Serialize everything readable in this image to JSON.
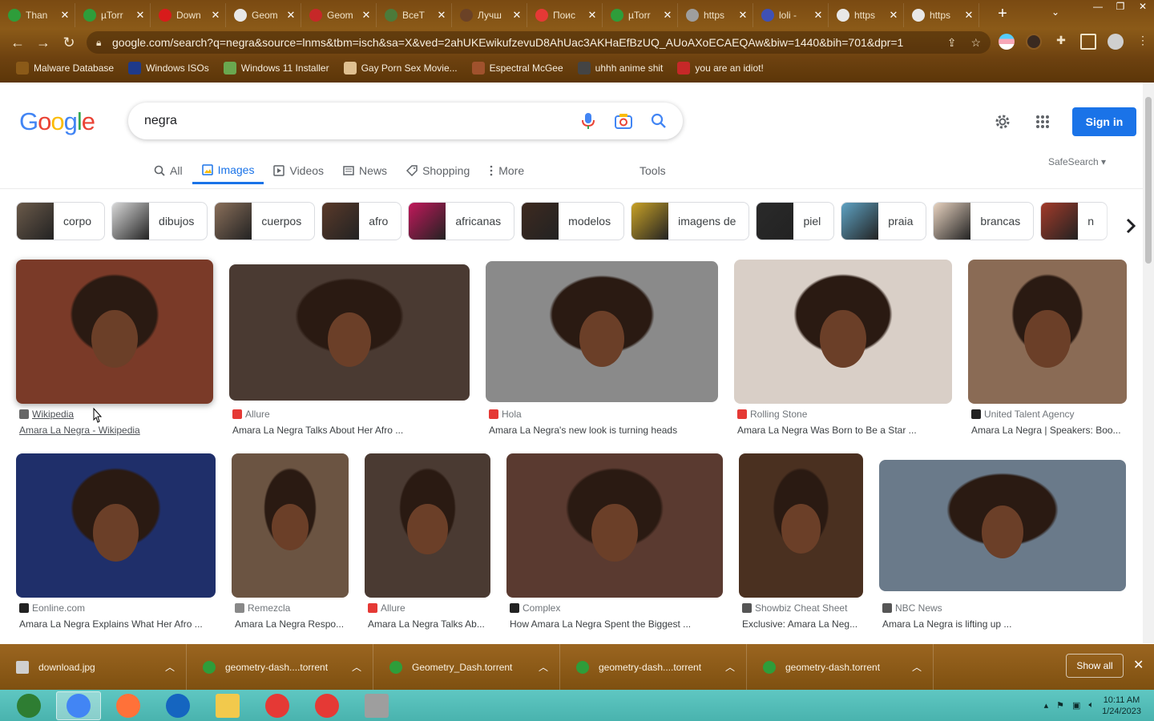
{
  "browser": {
    "tabs": [
      {
        "label": "Than",
        "color": "#2e9d3a"
      },
      {
        "label": "µTorr",
        "color": "#2e9d3a"
      },
      {
        "label": "Down",
        "color": "#d81b1b"
      },
      {
        "label": "Geom",
        "color": "#e8e8e8"
      },
      {
        "label": "Geom",
        "color": "#c62828"
      },
      {
        "label": "ВсеТ",
        "color": "#4c7a3a"
      },
      {
        "label": "Лучш",
        "color": "#6b4226"
      },
      {
        "label": "Поис",
        "color": "#e53935"
      },
      {
        "label": "µTorr",
        "color": "#2e9d3a"
      },
      {
        "label": "https",
        "color": "#9e9e9e"
      },
      {
        "label": "loli - ",
        "color": "#3f51b5"
      },
      {
        "label": "https",
        "color": "#e8e8e8"
      },
      {
        "label": "https",
        "color": "#e8e8e8"
      }
    ],
    "url": "google.com/search?q=negra&source=lnms&tbm=isch&sa=X&ved=2ahUKEwikufzevuD8AhUac3AKHaEfBzUQ_AUoAXoECAEQAw&biw=1440&bih=701&dpr=1",
    "bookmarks": [
      {
        "label": "Malware Database",
        "color": "#8b5a18"
      },
      {
        "label": "Windows ISOs",
        "color": "#1e3a8a"
      },
      {
        "label": "Windows 11 Installer",
        "color": "#6aa84f"
      },
      {
        "label": "Gay Porn Sex Movie...",
        "color": "#e0c090"
      },
      {
        "label": "Espectral McGee",
        "color": "#a0522d"
      },
      {
        "label": "uhhh anime shit",
        "color": "#444444"
      },
      {
        "label": "you are an idiot!",
        "color": "#c62828"
      }
    ]
  },
  "google": {
    "logo": [
      "G",
      "o",
      "o",
      "g",
      "l",
      "e"
    ],
    "query": "negra",
    "sign_in": "Sign in",
    "nav_tabs": [
      {
        "label": "All",
        "icon": "search-icon",
        "active": false
      },
      {
        "label": "Images",
        "icon": "image-icon",
        "active": true
      },
      {
        "label": "Videos",
        "icon": "play-icon",
        "active": false
      },
      {
        "label": "News",
        "icon": "news-icon",
        "active": false
      },
      {
        "label": "Shopping",
        "icon": "tag-icon",
        "active": false
      },
      {
        "label": "More",
        "icon": "dots-vertical-icon",
        "active": false
      }
    ],
    "tools": "Tools",
    "safesearch": "SafeSearch ▾",
    "chips": [
      {
        "label": "corpo",
        "color": "#6b5a4a"
      },
      {
        "label": "dibujos",
        "color": "#d9d9d9"
      },
      {
        "label": "cuerpos",
        "color": "#8a6f5a"
      },
      {
        "label": "afro",
        "color": "#5a3a2a"
      },
      {
        "label": "africanas",
        "color": "#c2185b"
      },
      {
        "label": "modelos",
        "color": "#3e2a20"
      },
      {
        "label": "imagens de",
        "color": "#c9a227"
      },
      {
        "label": "piel",
        "color": "#2a2a2a"
      },
      {
        "label": "praia",
        "color": "#5fa3c4"
      },
      {
        "label": "brancas",
        "color": "#e8d3c0"
      },
      {
        "label": "n",
        "color": "#a33b2a"
      }
    ]
  },
  "results": [
    {
      "source": "Wikipedia",
      "caption": "Amara La Negra - Wikipedia",
      "icon_color": "#666666",
      "img_color": "#7a3a28"
    },
    {
      "source": "Allure",
      "caption": "Amara La Negra Talks About Her Afro ...",
      "icon_color": "#e53935",
      "img_color": "#4a3a32"
    },
    {
      "source": "Hola",
      "caption": "Amara La Negra's new look is turning heads",
      "icon_color": "#e53935",
      "img_color": "#8a8a8a"
    },
    {
      "source": "Rolling Stone",
      "caption": "Amara La Negra Was Born to Be a Star ...",
      "icon_color": "#e53935",
      "img_color": "#d9cfc7"
    },
    {
      "source": "United Talent Agency",
      "caption": "Amara La Negra | Speakers: Boo...",
      "icon_color": "#222222",
      "img_color": "#8a6b55"
    },
    {
      "source": "Eonline.com",
      "caption": "Amara La Negra Explains What Her Afro ...",
      "icon_color": "#222222",
      "img_color": "#1f2f6a"
    },
    {
      "source": "Remezcla",
      "caption": "Amara La Negra Respo...",
      "icon_color": "#888888",
      "img_color": "#6b5442"
    },
    {
      "source": "Allure",
      "caption": "Amara La Negra Talks Ab...",
      "icon_color": "#e53935",
      "img_color": "#4a3a32"
    },
    {
      "source": "Complex",
      "caption": "How Amara La Negra Spent the Biggest ...",
      "icon_color": "#222222",
      "img_color": "#5a3a30"
    },
    {
      "source": "Showbiz Cheat Sheet",
      "caption": "Exclusive: Amara La Neg...",
      "icon_color": "#555555",
      "img_color": "#4a3020"
    },
    {
      "source": "NBC News",
      "caption": "Amara La Negra is lifting up ...",
      "icon_color": "#555555",
      "img_color": "#6a7a8a"
    }
  ],
  "downloads": {
    "items": [
      {
        "name": "download.jpg",
        "icon_color": "#cfcfcf"
      },
      {
        "name": "geometry-dash....torrent",
        "icon_color": "#2e9d3a"
      },
      {
        "name": "Geometry_Dash.torrent",
        "icon_color": "#2e9d3a"
      },
      {
        "name": "geometry-dash....torrent",
        "icon_color": "#2e9d3a"
      },
      {
        "name": "geometry-dash.torrent",
        "icon_color": "#2e9d3a"
      }
    ],
    "show_all": "Show all"
  },
  "taskbar": {
    "apps": [
      {
        "name": "start-orb-icon",
        "color": "#2e7d32"
      },
      {
        "name": "chrome-icon",
        "color": "#4285f4"
      },
      {
        "name": "firefox-icon",
        "color": "#ff7139"
      },
      {
        "name": "obama-logo-icon",
        "color": "#1565c0"
      },
      {
        "name": "file-explorer-icon",
        "color": "#f2c94c"
      },
      {
        "name": "yandex-browser-icon",
        "color": "#e53935"
      },
      {
        "name": "yandex-icon",
        "color": "#e53935"
      },
      {
        "name": "media-icon",
        "color": "#9e9e9e"
      }
    ],
    "time": "10:11 AM",
    "date": "1/24/2023"
  }
}
